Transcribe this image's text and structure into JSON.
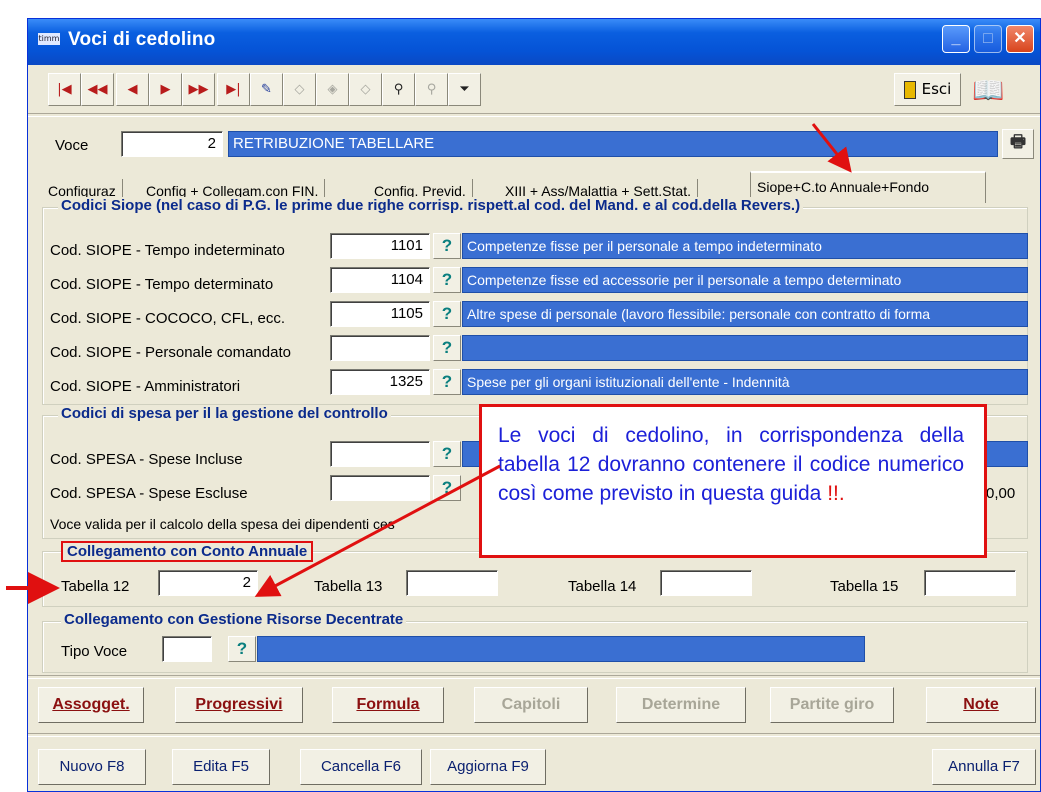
{
  "window": {
    "title": "Voci di cedolino",
    "app_icon": "timm"
  },
  "toolbar": {
    "nav_icons": [
      "first-record-icon",
      "prev-page-icon",
      "prev-record-icon",
      "next-record-icon",
      "next-page-icon",
      "last-record-icon"
    ],
    "exit_label": "Esci"
  },
  "voce": {
    "label": "Voce",
    "number": "2",
    "description": "RETRIBUZIONE TABELLARE"
  },
  "tabs": [
    "Configuraz",
    "Config + Collegam.con FIN.",
    "Config. Previd.",
    "XIII + Ass/Malattia + Sett.Stat.",
    "Siope+C.to Annuale+Fondo"
  ],
  "siope": {
    "title": "Codici Siope (nel caso di P.G. le prime due righe corrisp. rispett.al cod. del Mand. e al cod.della Revers.)",
    "rows": [
      {
        "label": "Cod. SIOPE - Tempo indeterminato",
        "code": "1101",
        "desc": "Competenze fisse per il personale a tempo indeterminato"
      },
      {
        "label": "Cod. SIOPE - Tempo determinato",
        "code": "1104",
        "desc": "Competenze fisse ed accessorie per il personale a tempo determinato"
      },
      {
        "label": "Cod. SIOPE - COCOCO, CFL, ecc.",
        "code": "1105",
        "desc": "Altre spese di personale (lavoro flessibile: personale con contratto di forma"
      },
      {
        "label": "Cod. SIOPE - Personale comandato",
        "code": "",
        "desc": ""
      },
      {
        "label": "Cod. SIOPE - Amministratori",
        "code": "1325",
        "desc": "Spese per gli organi istituzionali dell'ente - Indennità"
      }
    ]
  },
  "spesa": {
    "title": "Codici di spesa per il la gestione del controllo",
    "incluse_label": "Cod. SPESA - Spese Incluse",
    "escluse_label": "Cod. SPESA - Spese Escluse",
    "amount": "0,00",
    "valid_text": "Voce valida per il calcolo della spesa dei dipendenti ces"
  },
  "conto_annuale": {
    "title": "Collegamento con Conto Annuale",
    "fields": [
      {
        "label": "Tabella 12",
        "value": "2"
      },
      {
        "label": "Tabella 13",
        "value": ""
      },
      {
        "label": "Tabella 14",
        "value": ""
      },
      {
        "label": "Tabella 15",
        "value": ""
      }
    ]
  },
  "risorse": {
    "title": "Collegamento con Gestione Risorse Decentrate",
    "tipo_label": "Tipo Voce",
    "tipo_value": ""
  },
  "commands": {
    "assogget": "Assogget.",
    "progressivi": "Progressivi",
    "formula": "Formula",
    "capitoli": "Capitoli",
    "determine": "Determine",
    "partite": "Partite giro",
    "note": "Note"
  },
  "bottom": {
    "nuovo": "Nuovo F8",
    "edita": "Edita F5",
    "cancella": "Cancella F6",
    "aggiorna": "Aggiorna F9",
    "annulla": "Annulla F7"
  },
  "callout": {
    "text_main": "Le voci di cedolino, in corrispondenza della tabella 12 dovranno contenere il codice numerico così come previsto in questa guida ",
    "text_red": "!!."
  },
  "colors": {
    "accent": "#3a6fd2",
    "annotation": "#e01010",
    "callout_text": "#1c20d8"
  }
}
